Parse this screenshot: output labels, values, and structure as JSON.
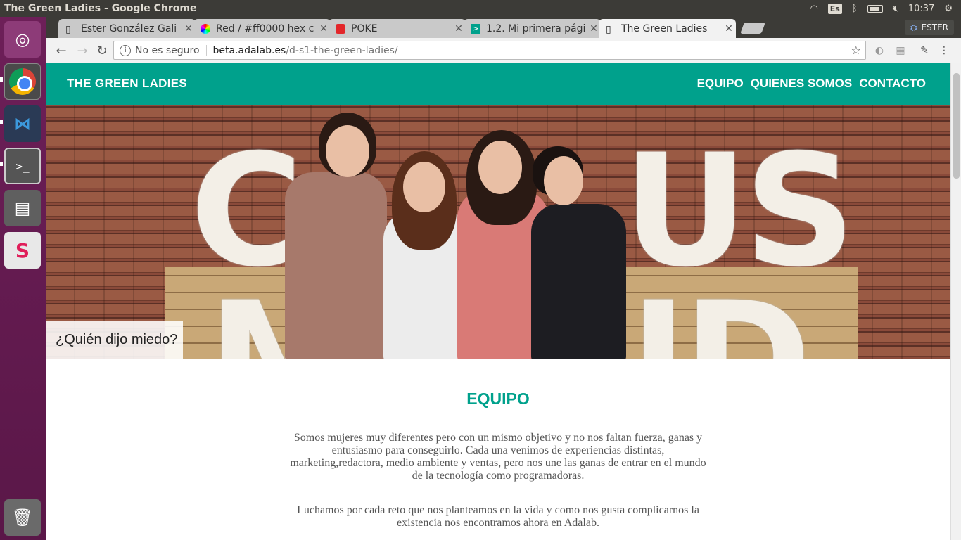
{
  "window": {
    "title": "The Green Ladies - Google Chrome"
  },
  "system_tray": {
    "keyboard": "Es",
    "time": "10:37"
  },
  "launcher": {
    "items": [
      {
        "name": "ubuntu-dash-icon"
      },
      {
        "name": "chrome-icon"
      },
      {
        "name": "vscode-icon"
      },
      {
        "name": "terminal-icon"
      },
      {
        "name": "files-icon"
      },
      {
        "name": "slack-icon"
      },
      {
        "name": "trash-icon"
      }
    ]
  },
  "browser": {
    "tabs": [
      {
        "label": "Ester González Gali",
        "icon": "page-icon",
        "active": false
      },
      {
        "label": "Red / #ff0000 hex c",
        "icon": "color-hex-icon",
        "active": false
      },
      {
        "label": "POKE",
        "icon": "pokemon-icon",
        "active": false
      },
      {
        "label": "1.2. Mi primera pági",
        "icon": "code-icon",
        "active": false
      },
      {
        "label": "The Green Ladies",
        "icon": "page-icon",
        "active": true
      }
    ],
    "user": "ESTER",
    "address": {
      "security": "No es seguro",
      "host": "beta.adalab.es",
      "path": "/d-s1-the-green-ladies/"
    }
  },
  "site": {
    "logo": "THE GREEN LADIES",
    "nav": [
      "EQUIPO",
      "QUIENES SOMOS",
      "CONTACTO"
    ],
    "hero_caption": "¿Quién dijo miedo?",
    "section_title": "EQUIPO",
    "paragraph_1": "Somos mujeres muy diferentes pero con un mismo objetivo y no nos faltan fuerza, ganas y entusiasmo para conseguirlo. Cada una venimos de experiencias distintas, marketing,redactora, medio ambiente y ventas, pero nos une las ganas de entrar en el mundo de la tecnología como programadoras.",
    "paragraph_2": "Luchamos por cada reto que nos planteamos en la vida y como nos gusta complicarnos la existencia nos encontramos ahora en Adalab.",
    "colors": {
      "brand": "#00a18c"
    }
  }
}
